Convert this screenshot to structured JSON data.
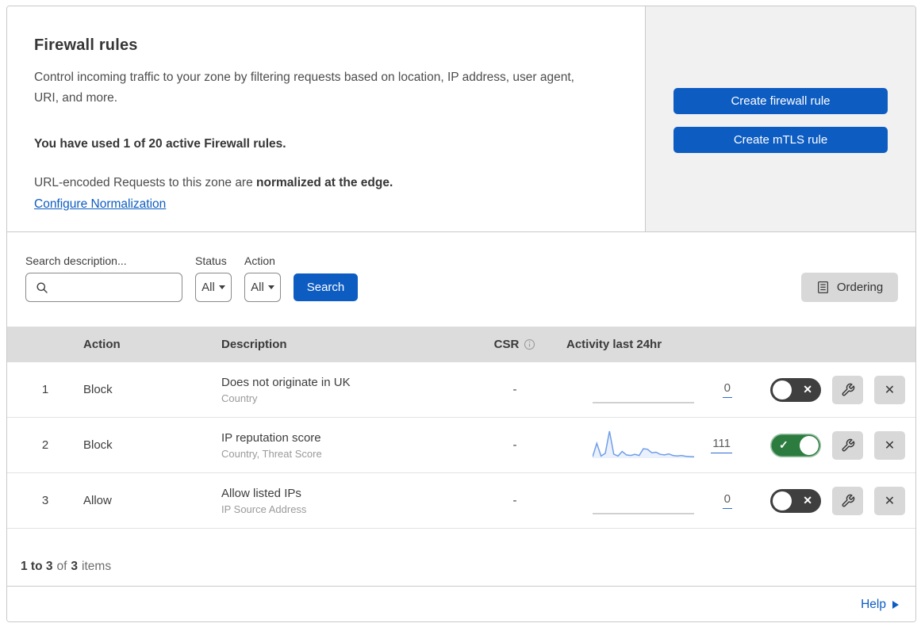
{
  "header": {
    "title": "Firewall rules",
    "description": "Control incoming traffic to your zone by filtering requests based on location, IP address, user agent, URI, and more.",
    "usage": "You have used 1 of 20 active Firewall rules.",
    "normalization_prefix": "URL-encoded Requests to this zone are ",
    "normalization_bold": "normalized at the edge.",
    "normalization_link": "Configure Normalization",
    "buttons": [
      {
        "label": "Create firewall rule"
      },
      {
        "label": "Create mTLS rule"
      }
    ]
  },
  "filters": {
    "search_label": "Search description...",
    "search_value": "",
    "status_label": "Status",
    "status_value": "All",
    "action_label": "Action",
    "action_value": "All",
    "search_button": "Search",
    "ordering_button": "Ordering"
  },
  "table": {
    "columns": {
      "action": "Action",
      "description": "Description",
      "csr": "CSR",
      "activity": "Activity last 24hr"
    },
    "rows": [
      {
        "index": "1",
        "action": "Block",
        "description": "Does not originate in UK",
        "fields": "Country",
        "csr": "-",
        "activity_count": "0",
        "enabled": false,
        "sparkline": []
      },
      {
        "index": "2",
        "action": "Block",
        "description": "IP reputation score",
        "fields": "Country, Threat Score",
        "csr": "-",
        "activity_count": "111",
        "enabled": true,
        "sparkline": [
          5,
          55,
          8,
          18,
          100,
          15,
          8,
          25,
          12,
          10,
          14,
          10,
          35,
          33,
          20,
          22,
          14,
          12,
          16,
          10,
          8,
          10,
          7,
          6,
          5
        ]
      },
      {
        "index": "3",
        "action": "Allow",
        "description": "Allow listed IPs",
        "fields": "IP Source Address",
        "csr": "-",
        "activity_count": "0",
        "enabled": false,
        "sparkline": []
      }
    ]
  },
  "footer": {
    "range": "1 to 3",
    "of_label": "of",
    "total": "3",
    "items_label": "items",
    "help_label": "Help"
  },
  "icons": {
    "search": "magnifier-svg",
    "info": "circle-i-svg",
    "ordering": "list-document-svg",
    "wrench": "wrench-svg",
    "close": "✕",
    "toggle_on": "✓",
    "toggle_off": "✕",
    "caret_down": "css-triangle",
    "help_arrow": "css-triangle"
  },
  "colors": {
    "accent_blue": "#0d5cc2",
    "link_blue": "#0d5cc2",
    "panel_gray": "#f1f1f1",
    "header_gray": "#dcdcdc",
    "button_gray": "#d8d8d8",
    "toggle_off": "#3f3f3f",
    "toggle_on": "#2c7c3f",
    "sparkline": "#6f9ee8",
    "empty_sparkline": "#b3b3b3",
    "border": "#c9c9c9",
    "row_border": "#e2e2e2",
    "text_dark": "#363636",
    "text_muted": "#9a9a9a"
  }
}
